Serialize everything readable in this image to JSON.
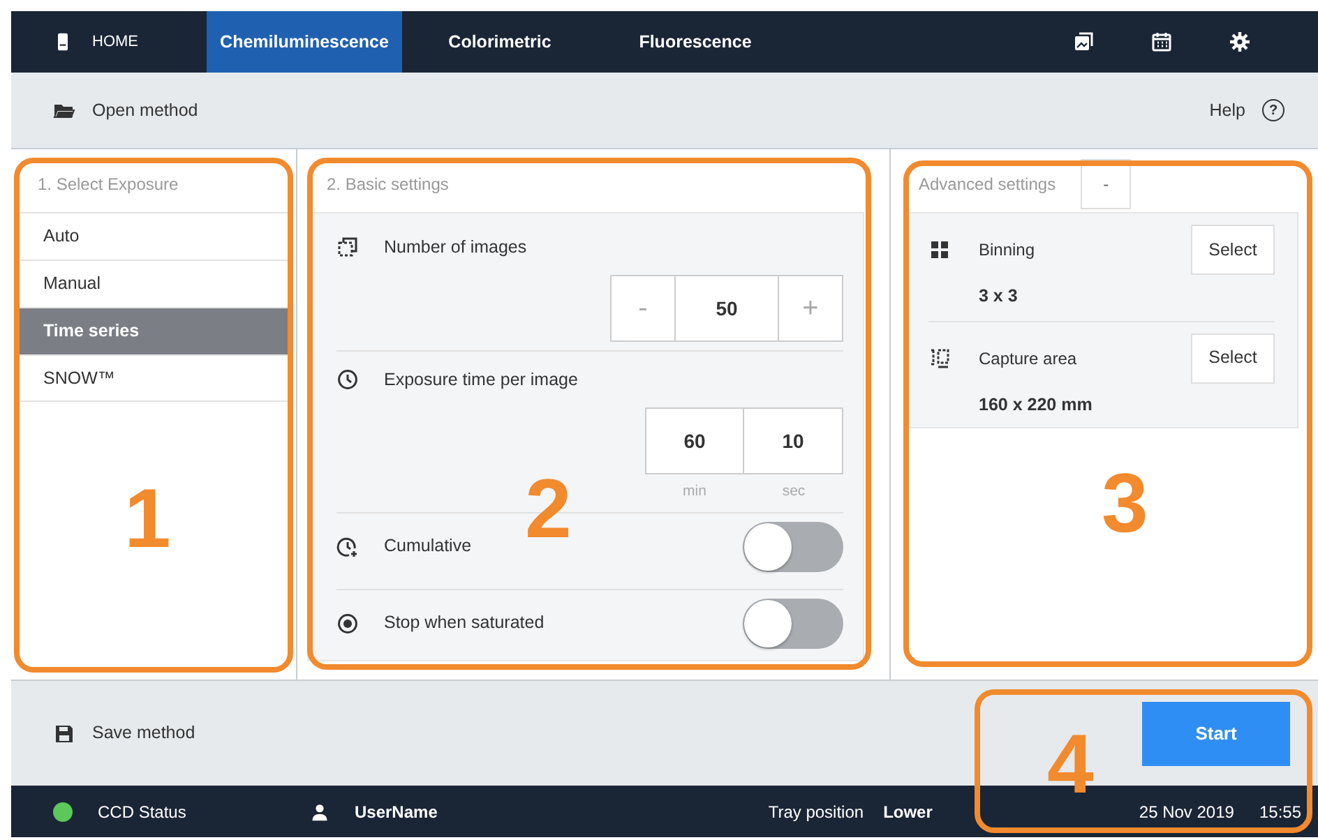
{
  "nav": {
    "home": "HOME",
    "tabs": [
      {
        "label": "Chemiluminescence",
        "selected": true
      },
      {
        "label": "Colorimetric",
        "selected": false
      },
      {
        "label": "Fluorescence",
        "selected": false
      }
    ]
  },
  "toolbar": {
    "open": "Open method",
    "help": "Help",
    "help_mark": "?"
  },
  "exposure": {
    "title": "1. Select Exposure",
    "items": [
      {
        "label": "Auto",
        "selected": false
      },
      {
        "label": "Manual",
        "selected": false
      },
      {
        "label": "Time series",
        "selected": true
      },
      {
        "label": "SNOW™",
        "selected": false
      }
    ]
  },
  "basic": {
    "title": "2. Basic settings",
    "images": {
      "label": "Number of images",
      "minus": "-",
      "value": "50",
      "plus": "+"
    },
    "exposure": {
      "label": "Exposure time per image",
      "fields": [
        {
          "value": "60",
          "unit": "min"
        },
        {
          "value": "10",
          "unit": "sec"
        }
      ]
    },
    "toggles": [
      {
        "kind": "cumulative",
        "label": "Cumulative",
        "on": false
      },
      {
        "kind": "saturated",
        "label": "Stop when saturated",
        "on": false
      }
    ]
  },
  "advanced": {
    "title": "Advanced settings",
    "collapse": "-",
    "items": [
      {
        "kind": "binning",
        "label": "Binning",
        "button": "Select",
        "value": "3 x 3"
      },
      {
        "kind": "area",
        "label": "Capture area",
        "button": "Select",
        "value": "160 x 220 mm"
      }
    ]
  },
  "footer": {
    "save": "Save method",
    "start": "Start"
  },
  "status_bar": {
    "ccd": {
      "label": "CCD Status",
      "color": "#5cc75a"
    },
    "user": "UserName",
    "tray_label": "Tray position",
    "tray": "Lower",
    "date": "25 Nov 2019",
    "time": "15:55"
  },
  "callouts": [
    {
      "label": "1"
    },
    {
      "label": "2"
    },
    {
      "label": "3"
    },
    {
      "label": "4"
    }
  ]
}
